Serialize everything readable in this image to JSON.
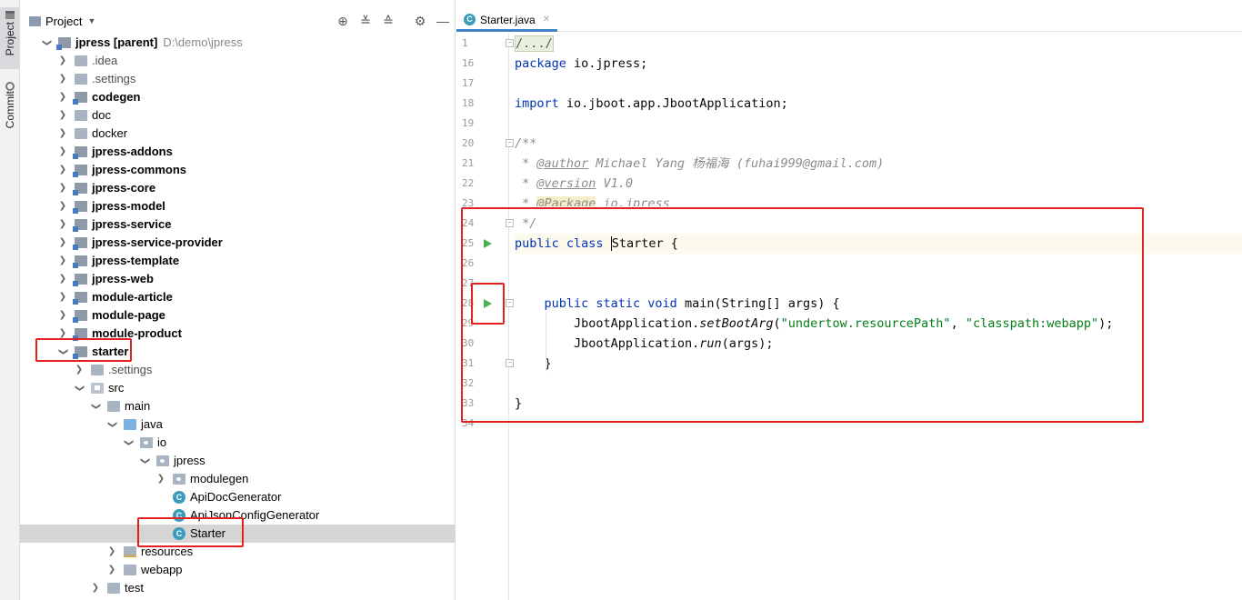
{
  "toolstrip": {
    "project_tab": "Project",
    "commit_tab": "Commit"
  },
  "panel": {
    "title": "Project",
    "tree": [
      {
        "label": "jpress [parent]",
        "path": "D:\\demo\\jpress",
        "icon": "module-folder-icon",
        "bold": true,
        "expanded": true
      },
      {
        "label": ".idea",
        "icon": "folder-icon",
        "muted": true
      },
      {
        "label": ".settings",
        "icon": "folder-icon",
        "muted": true
      },
      {
        "label": "codegen",
        "icon": "module-folder-icon",
        "bold": true
      },
      {
        "label": "doc",
        "icon": "folder-icon"
      },
      {
        "label": "docker",
        "icon": "folder-icon"
      },
      {
        "label": "jpress-addons",
        "icon": "module-folder-icon",
        "bold": true
      },
      {
        "label": "jpress-commons",
        "icon": "module-folder-icon",
        "bold": true
      },
      {
        "label": "jpress-core",
        "icon": "module-folder-icon",
        "bold": true
      },
      {
        "label": "jpress-model",
        "icon": "module-folder-icon",
        "bold": true
      },
      {
        "label": "jpress-service",
        "icon": "module-folder-icon",
        "bold": true
      },
      {
        "label": "jpress-service-provider",
        "icon": "module-folder-icon",
        "bold": true
      },
      {
        "label": "jpress-template",
        "icon": "module-folder-icon",
        "bold": true
      },
      {
        "label": "jpress-web",
        "icon": "module-folder-icon",
        "bold": true
      },
      {
        "label": "module-article",
        "icon": "module-folder-icon",
        "bold": true
      },
      {
        "label": "module-page",
        "icon": "module-folder-icon",
        "bold": true
      },
      {
        "label": "module-product",
        "icon": "module-folder-icon",
        "bold": true
      },
      {
        "label": "starter",
        "icon": "module-folder-icon",
        "bold": true,
        "expanded": true
      },
      {
        "label": ".settings",
        "icon": "folder-icon",
        "muted": true
      },
      {
        "label": "src",
        "icon": "source-folder-icon",
        "expanded": true
      },
      {
        "label": "main",
        "icon": "folder-icon",
        "expanded": true
      },
      {
        "label": "java",
        "icon": "java-folder-icon",
        "expanded": true
      },
      {
        "label": "io",
        "icon": "package-icon",
        "expanded": true
      },
      {
        "label": "jpress",
        "icon": "package-icon",
        "expanded": true
      },
      {
        "label": "modulegen",
        "icon": "package-icon"
      },
      {
        "label": "ApiDocGenerator",
        "icon": "java-class-icon"
      },
      {
        "label": "ApiJsonConfigGenerator",
        "icon": "java-class-icon"
      },
      {
        "label": "Starter",
        "icon": "java-class-icon",
        "selected": true
      },
      {
        "label": "resources",
        "icon": "resources-folder-icon"
      },
      {
        "label": "webapp",
        "icon": "folder-icon"
      },
      {
        "label": "test",
        "icon": "folder-icon"
      }
    ]
  },
  "editor": {
    "tab_label": "Starter.java",
    "line_numbers": [
      "1",
      "16",
      "17",
      "18",
      "19",
      "20",
      "21",
      "22",
      "23",
      "24",
      "25",
      "26",
      "27",
      "28",
      "29",
      "30",
      "31",
      "32",
      "33",
      "34"
    ],
    "code": {
      "l1": "/.../",
      "l16_kw": "package",
      "l16_rest": " io.jpress;",
      "l18_kw": "import",
      "l18_rest": " io.jboot.app.JbootApplication;",
      "l20": "/**",
      "l21_pre": " * ",
      "l21_tag": "@author",
      "l21_rest": " Michael Yang 杨福海 (fuhai999@gmail.com)",
      "l22_pre": " * ",
      "l22_tag": "@version",
      "l22_rest": " V1.0",
      "l23_pre": " * ",
      "l23_tag": "@Package",
      "l23_rest": " io.jpress",
      "l24": " */",
      "l25_kw": "public class",
      "l25_name": "Starter",
      "l25_rest": " {",
      "l28_kw": "public static void",
      "l28_rest": " main(String[] args) {",
      "l29_cls": "JbootApplication.",
      "l29_m": "setBootArg",
      "l29_a": "(",
      "l29_s1": "\"undertow.resourcePath\"",
      "l29_c": ", ",
      "l29_s2": "\"classpath:webapp\"",
      "l29_e": ");",
      "l30_cls": "JbootApplication.",
      "l30_m": "run",
      "l30_e": "(args);",
      "l31": "}",
      "l33": "}"
    }
  }
}
